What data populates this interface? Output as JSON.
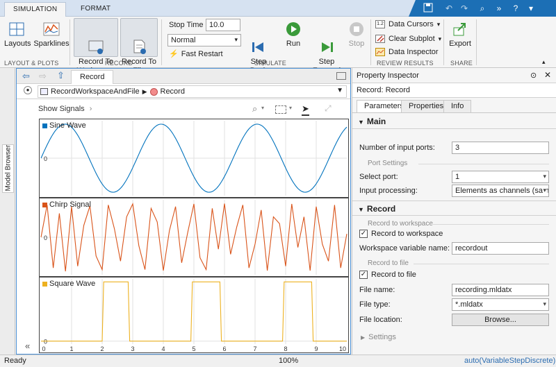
{
  "ribbon": {
    "tabs": [
      {
        "label": "SIMULATION",
        "active": true
      },
      {
        "label": "FORMAT",
        "active": false
      }
    ],
    "qat_icons": [
      "save-icon",
      "undo-icon",
      "redo-icon",
      "search-icon",
      "expand-icon",
      "help-icon",
      "dropdown-icon"
    ],
    "layout_plots": {
      "layouts": "Layouts",
      "sparklines": "Sparklines",
      "section": "LAYOUT & PLOTS"
    },
    "record": {
      "to_workspace": "Record To\nWorkspace",
      "to_file": "Record To\nFile",
      "section": "RECORD"
    },
    "simulate": {
      "stop_time_label": "Stop Time",
      "stop_time_value": "10.0",
      "mode_value": "Normal",
      "fast_restart": "Fast Restart",
      "step_back": "Step\nBack",
      "run": "Run",
      "step_forward": "Step\nForward",
      "stop": "Stop",
      "section": "SIMULATE"
    },
    "review": {
      "data_cursors": "Data Cursors",
      "clear_subplot": "Clear Subplot",
      "data_inspector": "Data Inspector",
      "section": "REVIEW RESULTS"
    },
    "share": {
      "export": "Export",
      "section": "SHARE"
    }
  },
  "model_browser": {
    "label": "Model Browser"
  },
  "editor": {
    "tab_label": "Record",
    "breadcrumb": {
      "model": "RecordWorkspaceAndFile",
      "block": "Record"
    },
    "show_signals": "Show Signals",
    "collapse_icon": "«"
  },
  "chart_data": [
    {
      "type": "line",
      "title": "",
      "series": [
        {
          "name": "Sine Wave",
          "color": "#0072bd",
          "amplitude": 1,
          "period": 3.14159
        }
      ],
      "xlim": [
        0,
        10
      ],
      "ylim": [
        -1.1,
        1.1
      ],
      "y_ticks": [
        "0"
      ],
      "grid": true
    },
    {
      "type": "line",
      "title": "",
      "series": [
        {
          "name": "Chirp Signal",
          "color": "#d95319",
          "x": [
            0,
            0.2,
            0.4,
            0.6,
            0.8,
            1,
            1.2,
            1.4,
            1.6,
            1.8,
            2,
            2.2,
            2.4,
            2.6,
            2.8,
            3,
            3.2,
            3.4,
            3.6,
            3.8,
            4,
            4.2,
            4.4,
            4.6,
            4.8,
            5,
            5.2,
            5.4,
            5.6,
            5.8,
            6,
            6.2,
            6.4,
            6.6,
            6.8,
            7,
            7.2,
            7.4,
            7.6,
            7.8,
            8,
            8.2,
            8.4,
            8.6,
            8.8,
            9,
            9.2,
            9.4,
            9.6,
            9.8,
            10
          ],
          "values": [
            0,
            0.95,
            -0.9,
            0.7,
            -1,
            0.9,
            -0.85,
            0.35,
            0.92,
            -0.55,
            -0.95,
            0.95,
            0.25,
            -0.7,
            0.6,
            0.98,
            -0.25,
            -0.95,
            0.85,
            0.45,
            -0.98,
            0.2,
            0.9,
            -0.75,
            0.15,
            0.98,
            -0.6,
            -0.95,
            0.85,
            -0.35,
            0.99,
            -0.5,
            0.3,
            0.95,
            -0.9,
            -0.2,
            0.8,
            -0.98,
            0.6,
            0.4,
            -0.85,
            0.98,
            -0.3,
            0.6,
            -0.98,
            0.9,
            -0.2,
            -0.7,
            0.95,
            -0.9,
            0.1
          ]
        }
      ],
      "xlim": [
        0,
        10
      ],
      "ylim": [
        -1.1,
        1.1
      ],
      "y_ticks": [
        "0"
      ],
      "grid": true
    },
    {
      "type": "line",
      "title": "",
      "series": [
        {
          "name": "Square Wave",
          "color": "#edb120",
          "x": [
            0,
            2,
            2.05,
            2.85,
            2.9,
            4.9,
            4.95,
            5.85,
            5.9,
            7.9,
            7.95,
            8.85,
            8.9,
            10
          ],
          "values": [
            0,
            0,
            1,
            1,
            0,
            0,
            1,
            1,
            0,
            0,
            1,
            1,
            0,
            0
          ]
        }
      ],
      "xlim": [
        0,
        10
      ],
      "ylim": [
        -0.05,
        1.05
      ],
      "x_ticks": [
        "0",
        "1",
        "2",
        "3",
        "4",
        "5",
        "6",
        "7",
        "8",
        "9",
        "10"
      ],
      "y_ticks": [
        "0"
      ],
      "grid": true
    }
  ],
  "inspector": {
    "title": "Property Inspector",
    "subtitle": "Record: Record",
    "tabs": [
      "Parameters",
      "Properties",
      "Info"
    ],
    "main_section": "Main",
    "num_ports_label": "Number of input ports:",
    "num_ports_value": "3",
    "port_settings_group": "Port Settings",
    "select_port_label": "Select port:",
    "select_port_value": "1",
    "input_processing_label": "Input processing:",
    "input_processing_value": "Elements as channels (sample",
    "record_section": "Record",
    "record_to_workspace_group": "Record to workspace",
    "record_to_workspace_check": "Record to workspace",
    "workspace_var_label": "Workspace variable name:",
    "workspace_var_value": "recordout",
    "record_to_file_group": "Record to file",
    "record_to_file_check": "Record to file",
    "file_name_label": "File name:",
    "file_name_value": "recording.mldatx",
    "file_type_label": "File type:",
    "file_type_value": "*.mldatx",
    "file_location_label": "File location:",
    "browse_button": "Browse...",
    "settings_section": "Settings"
  },
  "status": {
    "left": "Ready",
    "zoom": "100%",
    "solver": "auto(VariableStepDiscrete)"
  }
}
